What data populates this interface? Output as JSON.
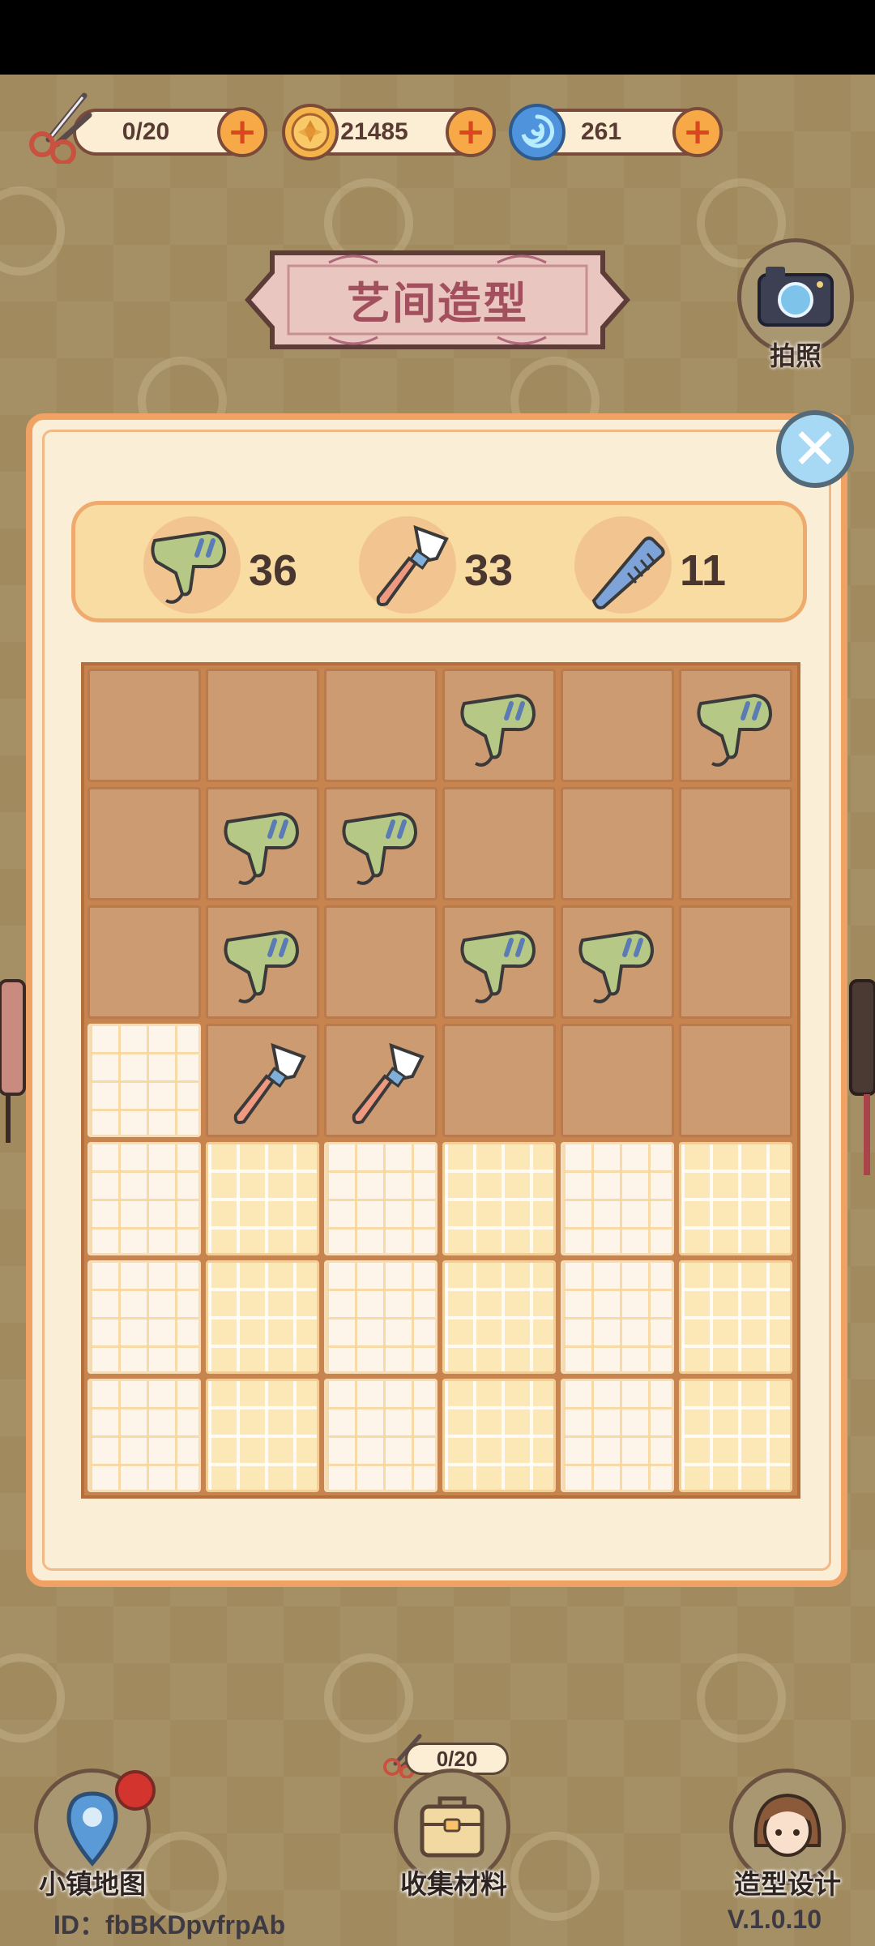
{
  "resources": {
    "scissors": {
      "value": "0/20",
      "icon": "scissors-icon"
    },
    "coins": {
      "value": "21485",
      "icon": "coin-icon"
    },
    "gems": {
      "value": "261",
      "icon": "swirl-gem-icon"
    }
  },
  "header": {
    "title": "艺间造型",
    "camera_label": "拍照"
  },
  "tools": [
    {
      "name": "hair-dryer",
      "count": "36"
    },
    {
      "name": "makeup-brush",
      "count": "33"
    },
    {
      "name": "comb",
      "count": "11"
    }
  ],
  "grid": {
    "cols": 6,
    "rows": 7,
    "cells": [
      [
        "unlocked",
        "unlocked",
        "unlocked",
        "unlocked",
        "unlocked",
        "unlocked"
      ],
      [
        "unlocked",
        "unlocked",
        "unlocked",
        "unlocked",
        "unlocked",
        "unlocked"
      ],
      [
        "unlocked",
        "unlocked",
        "unlocked",
        "unlocked",
        "unlocked",
        "unlocked"
      ],
      [
        "locked-w",
        "unlocked",
        "unlocked",
        "unlocked",
        "unlocked",
        "unlocked"
      ],
      [
        "locked-w",
        "locked-y",
        "locked-w",
        "locked-y",
        "locked-w",
        "locked-y"
      ],
      [
        "locked-w",
        "locked-y",
        "locked-w",
        "locked-y",
        "locked-w",
        "locked-y"
      ],
      [
        "locked-w",
        "locked-y",
        "locked-w",
        "locked-y",
        "locked-w",
        "locked-y"
      ]
    ],
    "items": [
      {
        "row": 0,
        "col": 3,
        "item": "hair-dryer"
      },
      {
        "row": 0,
        "col": 5,
        "item": "hair-dryer"
      },
      {
        "row": 1,
        "col": 1,
        "item": "hair-dryer"
      },
      {
        "row": 1,
        "col": 2,
        "item": "hair-dryer"
      },
      {
        "row": 2,
        "col": 1,
        "item": "hair-dryer"
      },
      {
        "row": 2,
        "col": 3,
        "item": "hair-dryer"
      },
      {
        "row": 2,
        "col": 4,
        "item": "hair-dryer"
      },
      {
        "row": 3,
        "col": 1,
        "item": "makeup-brush"
      },
      {
        "row": 3,
        "col": 2,
        "item": "makeup-brush"
      }
    ]
  },
  "nav": {
    "map_label": "小镇地图",
    "collect_label": "收集材料",
    "collect_counter": "0/20",
    "design_label": "造型设计"
  },
  "footer": {
    "id_text": "ID：fbBKDpvfrpAb",
    "version": "V.1.0.10"
  },
  "colors": {
    "panel_border": "#f0a264",
    "accent_plus": "#f7a948",
    "title_text": "#a24f5e"
  }
}
